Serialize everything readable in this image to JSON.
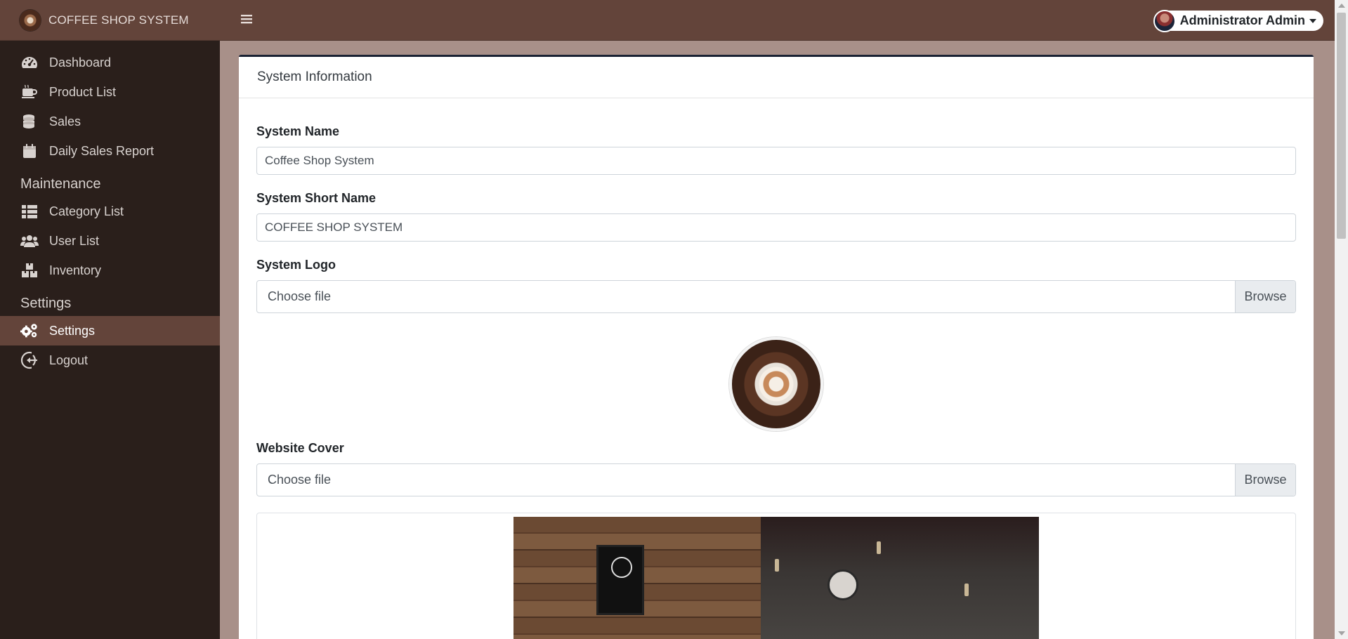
{
  "brand": {
    "name": "COFFEE SHOP SYSTEM"
  },
  "sidebar": {
    "items": [
      {
        "label": "Dashboard",
        "icon": "tachometer-icon"
      },
      {
        "label": "Product List",
        "icon": "coffee-mug-icon"
      },
      {
        "label": "Sales",
        "icon": "coins-icon"
      },
      {
        "label": "Daily Sales Report",
        "icon": "calendar-icon"
      }
    ],
    "maintenance_header": "Maintenance",
    "maintenance_items": [
      {
        "label": "Category List",
        "icon": "list-icon"
      },
      {
        "label": "User List",
        "icon": "users-icon"
      },
      {
        "label": "Inventory",
        "icon": "boxes-icon"
      }
    ],
    "settings_header": "Settings",
    "settings_items": [
      {
        "label": "Settings",
        "icon": "cogs-icon",
        "active": true
      },
      {
        "label": "Logout",
        "icon": "sign-out-icon"
      }
    ]
  },
  "topbar": {
    "user_name": "Administrator Admin"
  },
  "card": {
    "title": "System Information"
  },
  "form": {
    "system_name_label": "System Name",
    "system_name_value": "Coffee Shop System",
    "short_name_label": "System Short Name",
    "short_name_value": "COFFEE SHOP SYSTEM",
    "logo_label": "System Logo",
    "logo_file_text": "Choose file",
    "logo_browse": "Browse",
    "cover_label": "Website Cover",
    "cover_file_text": "Choose file",
    "cover_browse": "Browse"
  },
  "colors": {
    "sidebar_bg": "#2a1f1b",
    "brand_bg": "#63443a",
    "page_bg": "#a89089",
    "card_top_border": "#1a2233"
  }
}
